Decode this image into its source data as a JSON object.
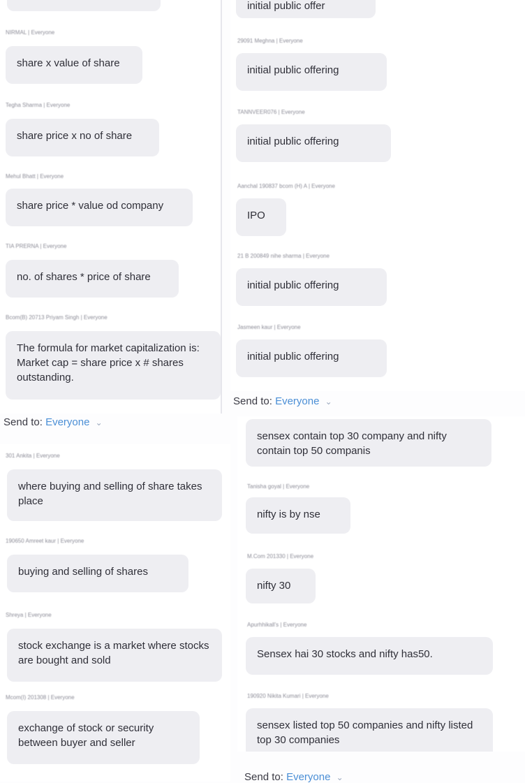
{
  "left_column": {
    "top_messages": [
      {
        "sender": "NIRMAL | Everyone",
        "text": "share x value of share"
      },
      {
        "sender": "Tegha Sharma | Everyone",
        "text": "share price x no of share"
      },
      {
        "sender": "Mehul Bhatt | Everyone",
        "text": "share price * value od company"
      },
      {
        "sender": "TIA PRERNA | Everyone",
        "text": "no. of shares * price of share"
      },
      {
        "sender": "Bcom(B) 20713 Priyam Singh | Everyone",
        "text": "The formula for market capitalization is: Market cap = share price x # shares outstanding."
      }
    ],
    "send_to": {
      "label": "Send to:",
      "target": "Everyone",
      "chevron": "⌄"
    },
    "bottom_messages": [
      {
        "sender": "301 Ankita | Everyone",
        "text": "where buying and selling of share takes place"
      },
      {
        "sender": "190650 Amreet kaur | Everyone",
        "text": "buying and selling of shares"
      },
      {
        "sender": "Shreya | Everyone",
        "text": "stock exchange is a market where stocks are bought and sold"
      },
      {
        "sender": "Mcom(I) 201308 | Everyone",
        "text": "exchange of stock or security between buyer and seller"
      }
    ]
  },
  "right_column": {
    "top_partial_text": "initial public offer",
    "top_messages": [
      {
        "sender": "29091 Meghna | Everyone",
        "text": "initial public offering"
      },
      {
        "sender": "TANNVEER076 | Everyone",
        "text": "initial public offering"
      },
      {
        "sender": "Aanchal 190837 bcom (H) A | Everyone",
        "text": "IPO"
      },
      {
        "sender": "21 B 200849 nihe sharma | Everyone",
        "text": "initial public offering"
      },
      {
        "sender": "Jasmeen kaur | Everyone",
        "text": "initial public offering"
      }
    ],
    "send_to": {
      "label": "Send to:",
      "target": "Everyone",
      "chevron": "⌄"
    },
    "bottom_messages": [
      {
        "sender": "",
        "text": "sensex contain top 30 company and nifty contain top 50 companis"
      },
      {
        "sender": "Tanisha goyal | Everyone",
        "text": "nifty is by nse"
      },
      {
        "sender": "M.Com 201330 | Everyone",
        "text": "nifty 30"
      },
      {
        "sender": "Apurhhikall's | Everyone",
        "text": "Sensex hai 30 stocks and nifty has50."
      },
      {
        "sender": "190920 Nikita Kumari | Everyone",
        "text": "sensex listed top 50 companies and nifty listed top 30 companies"
      }
    ],
    "bottom_send_to": {
      "label": "Send to:",
      "target": "Everyone",
      "chevron": "⌄"
    }
  }
}
